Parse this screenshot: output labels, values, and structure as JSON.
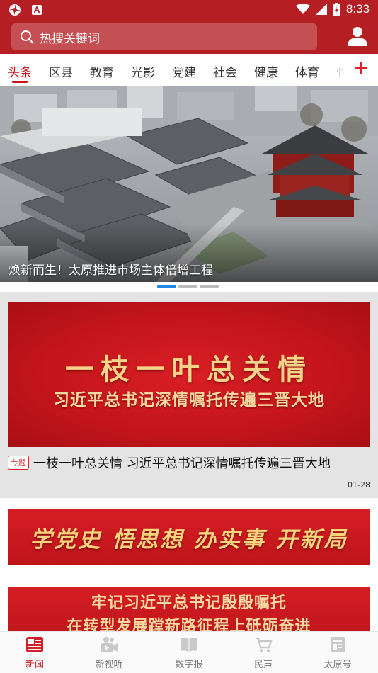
{
  "status_bar": {
    "time": "8:33",
    "icons": [
      "app-notification-icon",
      "a-badge-icon",
      "wifi-icon",
      "signal-icon",
      "battery-icon"
    ]
  },
  "header": {
    "search_placeholder": "热搜关键词",
    "icons": [
      "search-icon",
      "user-icon"
    ]
  },
  "tabs": {
    "items": [
      "头条",
      "区县",
      "教育",
      "光影",
      "党建",
      "社会",
      "健康",
      "体育",
      "忄"
    ],
    "active_index": 0,
    "add_label": "+"
  },
  "hero": {
    "caption": "焕新而生！太原推进市场主体倍增工程",
    "slide_count": 3,
    "active_slide": 0
  },
  "feed": [
    {
      "banner_line1": "一枝一叶总关情",
      "banner_line2": "习近平总书记深情嘱托传遍三晋大地",
      "tag": "专题",
      "title": "一枝一叶总关情 习近平总书记深情嘱托传遍三晋大地",
      "date": "01-28"
    },
    {
      "banner_text": "学党史 悟思想 办实事 开新局"
    },
    {
      "banner_line1": "牢记习近平总书记殷殷嘱托",
      "banner_line2": "在转型发展蹚新路征程上砥砺奋进"
    }
  ],
  "bottom_nav": {
    "items": [
      {
        "label": "新闻",
        "icon": "news-icon",
        "active": true
      },
      {
        "label": "新视听",
        "icon": "video-icon",
        "active": false
      },
      {
        "label": "数字报",
        "icon": "book-icon",
        "active": false
      },
      {
        "label": "民声",
        "icon": "cart-icon",
        "active": false
      },
      {
        "label": "太原号",
        "icon": "account-icon",
        "active": false
      }
    ]
  },
  "colors": {
    "brand_red": "#b51f24",
    "accent_red": "#c8161d",
    "banner_gold": "#f5d48a",
    "dot_active": "#1e88e5"
  }
}
